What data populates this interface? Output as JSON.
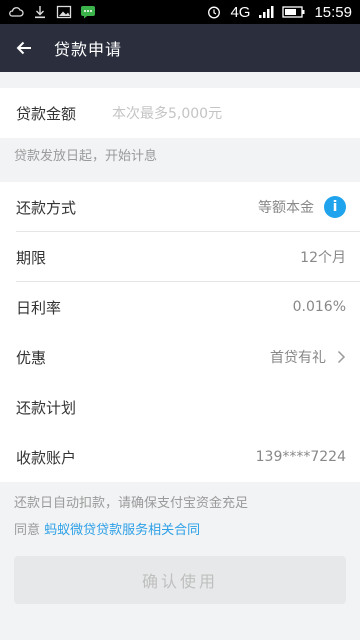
{
  "status": {
    "network": "4G",
    "time": "15:59"
  },
  "header": {
    "title": "贷款申请"
  },
  "amount": {
    "label": "贷款金额",
    "placeholder": "本次最多5,000元"
  },
  "interest_note": "贷款发放日起，开始计息",
  "repay_method": {
    "label": "还款方式",
    "value": "等额本金"
  },
  "term": {
    "label": "期限",
    "value": "12个月"
  },
  "daily_rate": {
    "label": "日利率",
    "value": "0.016%"
  },
  "discount": {
    "label": "优惠",
    "value": "首贷有礼"
  },
  "repay_plan": {
    "label": "还款计划"
  },
  "account": {
    "label": "收款账户",
    "value": "139****7224"
  },
  "footer": {
    "auto_deduct": "还款日自动扣款，请确保支付宝资金充足",
    "agree_prefix": "同意",
    "agree_link": "蚂蚁微贷贷款服务相关合同"
  },
  "submit_label": "确认使用",
  "colors": {
    "appbar": "#2b2f3d",
    "link": "#2da0e6",
    "info": "#1fa3ec"
  }
}
